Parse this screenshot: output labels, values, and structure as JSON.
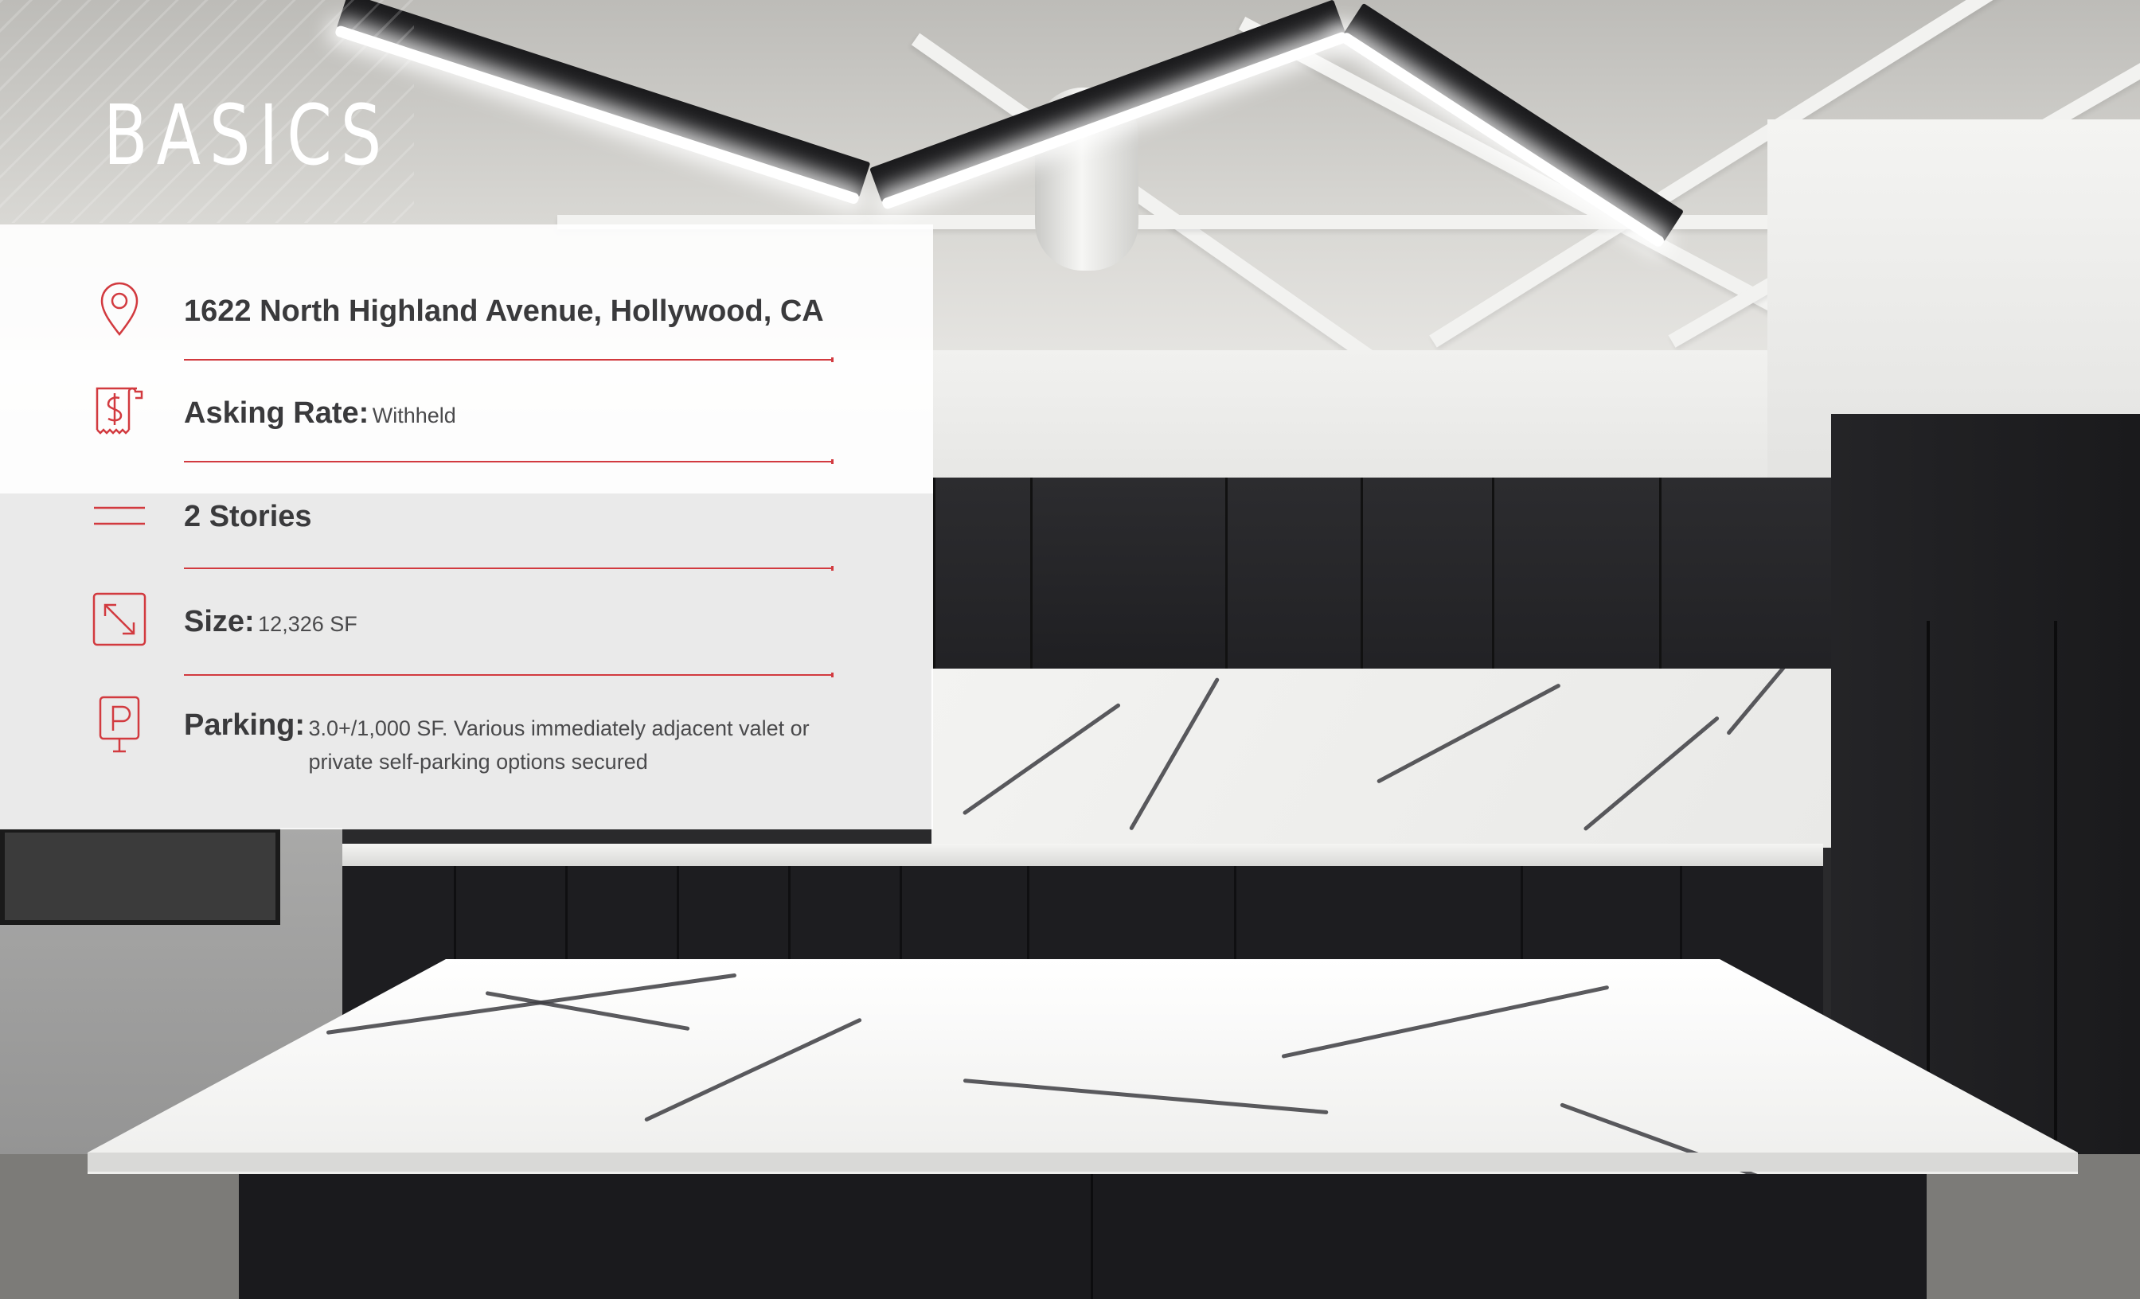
{
  "page": {
    "title": "BASICS",
    "accent_color": "#d23a3f"
  },
  "details": [
    {
      "icon": "location-pin-icon",
      "label": "1622 North Highland Avenue, Hollywood, CA",
      "value": ""
    },
    {
      "icon": "receipt-dollar-icon",
      "label": "Asking Rate:",
      "value": "Withheld"
    },
    {
      "icon": "stories-lines-icon",
      "label": "2 Stories",
      "value": ""
    },
    {
      "icon": "size-arrow-icon",
      "label": "Size:",
      "value": "12,326 SF"
    },
    {
      "icon": "parking-sign-icon",
      "label": "Parking:",
      "value": "3.0+/1,000 SF. Various immediately adjacent valet or private self-parking options secured"
    }
  ]
}
